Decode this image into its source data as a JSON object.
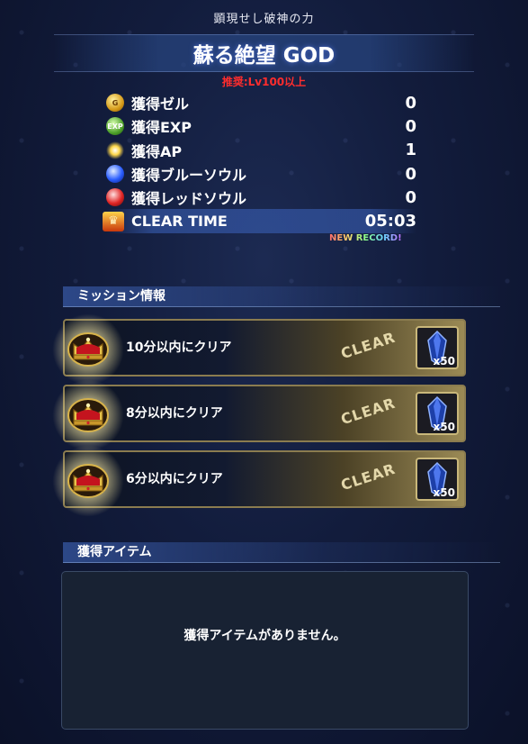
{
  "header": {
    "subtitle": "顕現せし破神の力",
    "title": "蘇る絶望 GOD",
    "recommended": "推奨:Lv100以上"
  },
  "rewards": [
    {
      "icon": "gil-icon",
      "label": "獲得ゼル",
      "value": "0"
    },
    {
      "icon": "exp-icon",
      "label": "獲得EXP",
      "value": "0"
    },
    {
      "icon": "ap-icon",
      "label": "獲得AP",
      "value": "1"
    },
    {
      "icon": "blue-soul-icon",
      "label": "獲得ブルーソウル",
      "value": "0"
    },
    {
      "icon": "red-soul-icon",
      "label": "獲得レッドソウル",
      "value": "0"
    }
  ],
  "clear_time": {
    "icon": "trophy-icon",
    "label": "CLEAR TIME",
    "value": "05:03",
    "new_record": "NEW RECORD!"
  },
  "missions": {
    "heading": "ミッション情報",
    "items": [
      {
        "text": "10分以内にクリア",
        "status": "CLEAR",
        "reward_icon": "crystal-icon",
        "reward_qty": "x50"
      },
      {
        "text": "8分以内にクリア",
        "status": "CLEAR",
        "reward_icon": "crystal-icon",
        "reward_qty": "x50"
      },
      {
        "text": "6分以内にクリア",
        "status": "CLEAR",
        "reward_icon": "crystal-icon",
        "reward_qty": "x50"
      }
    ]
  },
  "items_section": {
    "heading": "獲得アイテム",
    "empty_message": "獲得アイテムがありません。"
  },
  "colors": {
    "background": "#121c3c",
    "recommended_text": "#ff2d2d",
    "mission_border": "#8b7c4f"
  }
}
